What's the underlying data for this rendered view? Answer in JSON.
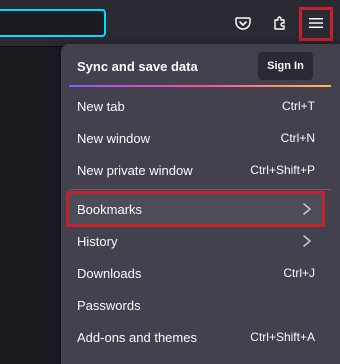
{
  "menu": {
    "sync_label": "Sync and save data",
    "signin_label": "Sign In",
    "items": [
      {
        "label": "New tab",
        "shortcut": "Ctrl+T"
      },
      {
        "label": "New window",
        "shortcut": "Ctrl+N"
      },
      {
        "label": "New private window",
        "shortcut": "Ctrl+Shift+P"
      },
      {
        "label": "Bookmarks",
        "shortcut": ""
      },
      {
        "label": "History",
        "shortcut": ""
      },
      {
        "label": "Downloads",
        "shortcut": "Ctrl+J"
      },
      {
        "label": "Passwords",
        "shortcut": ""
      },
      {
        "label": "Add-ons and themes",
        "shortcut": "Ctrl+Shift+A"
      }
    ]
  },
  "colors": {
    "highlight": "#c5222e",
    "panel": "#42414d",
    "toolbar": "#2b2a33",
    "focus_ring": "#00ddff"
  }
}
